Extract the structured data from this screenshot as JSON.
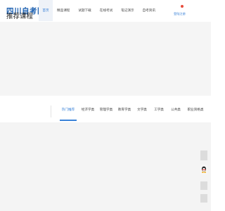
{
  "header": {
    "logo_text": "四川自考网",
    "nav": [
      "首页",
      "精品课程",
      "试题下载",
      "在线考试",
      "笔记演示",
      "自考资讯"
    ],
    "user_link": "登陆注册"
  },
  "recommend": {
    "title": "推荐课程",
    "tabs": [
      "热门推荐",
      "经济学类",
      "管理学类",
      "教育学类",
      "文学类",
      "工学类",
      "公共类",
      "职业资格类"
    ]
  },
  "colors": {
    "accent": "#3a82d8",
    "logo": "#1b5fb0",
    "banner_bg": "#f5f5f5",
    "content_bg": "#f4f4f4"
  }
}
